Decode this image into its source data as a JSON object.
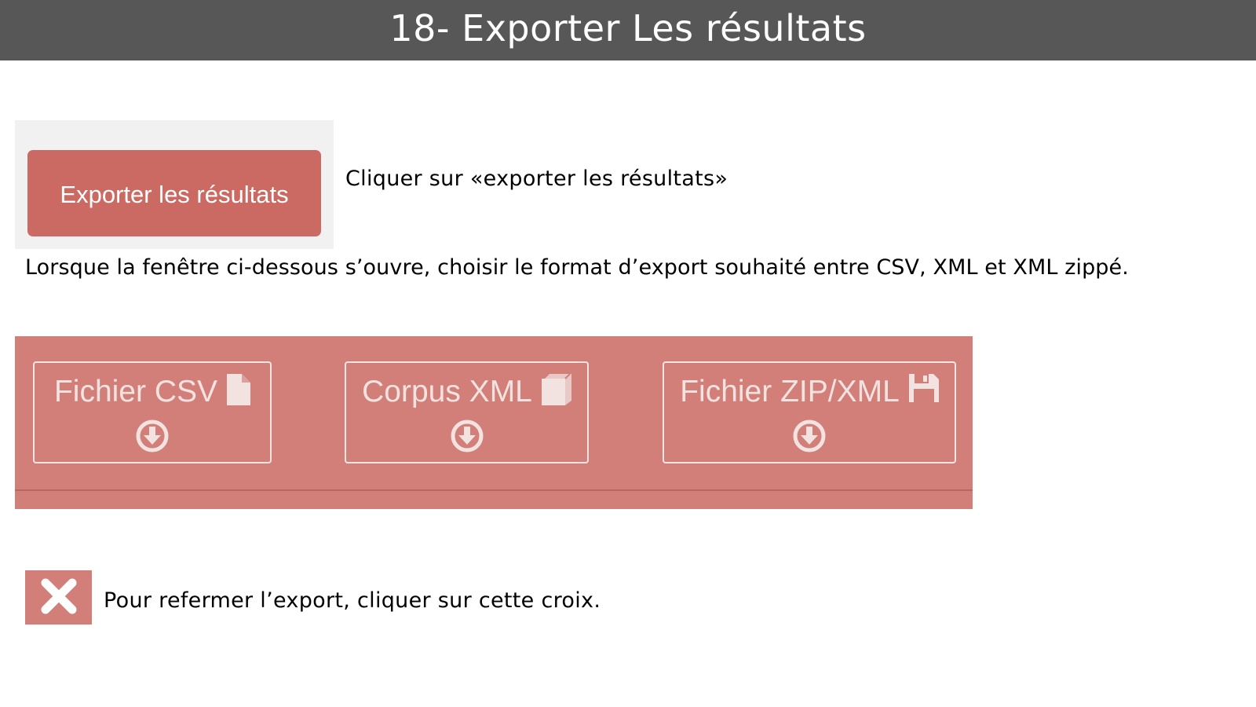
{
  "header": {
    "title": "18- Exporter Les résultats"
  },
  "step1": {
    "button_label": "Exporter les résultats",
    "instruction": "Cliquer sur «exporter les résultats»"
  },
  "step2": {
    "instruction": "Lorsque la fenêtre ci-dessous s’ouvre, choisir le format d’export souhaité entre CSV, XML  et XML zippé."
  },
  "export_panel": {
    "options": [
      {
        "label": "Fichier CSV",
        "icon": "file-icon"
      },
      {
        "label": "Corpus XML",
        "icon": "book-icon"
      },
      {
        "label": "Fichier ZIP/XML",
        "icon": "floppy-disk-icon"
      }
    ],
    "download_icon": "arrow-circle-down-icon"
  },
  "step3": {
    "close_icon": "close-x-icon",
    "instruction": "Pour refermer l’export, cliquer sur cette croix."
  },
  "colors": {
    "header_bg": "#575757",
    "button_red": "#cb6a63",
    "panel_pink": "#d17f78",
    "panel_text": "#f2e2e0"
  }
}
